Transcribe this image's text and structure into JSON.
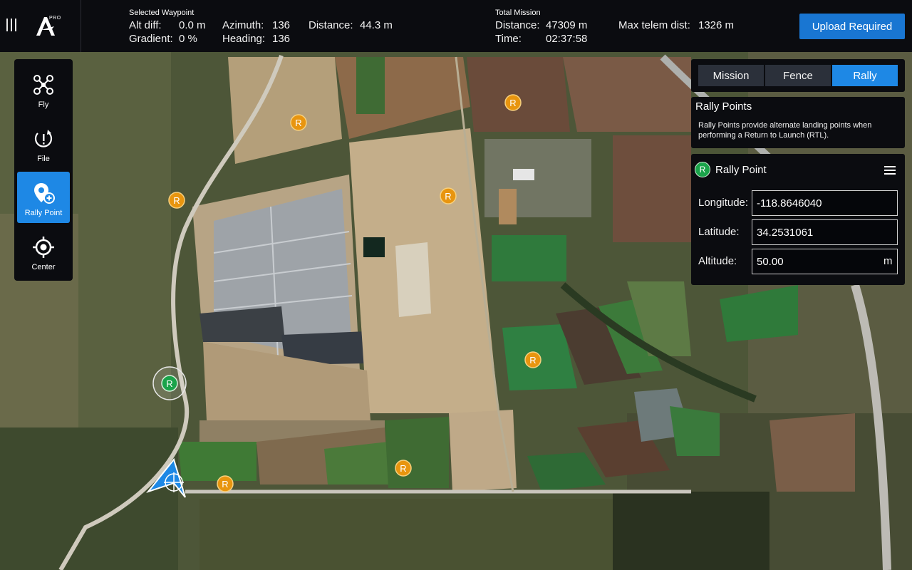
{
  "topbar": {
    "menu_icon": "hamburger-icon",
    "logo_icon": "app-logo-icon",
    "logo_badge": "PRO",
    "selected_waypoint": {
      "heading": "Selected Waypoint",
      "alt_diff_label": "Alt diff:",
      "alt_diff_value": "0.0 m",
      "gradient_label": "Gradient:",
      "gradient_value": "0 %",
      "azimuth_label": "Azimuth:",
      "azimuth_value": "136",
      "heading_label": "Heading:",
      "heading_value": "136",
      "distance_label": "Distance:",
      "distance_value": "44.3 m"
    },
    "total_mission": {
      "heading": "Total Mission",
      "distance_label": "Distance:",
      "distance_value": "47309 m",
      "time_label": "Time:",
      "time_value": "02:37:58",
      "max_telem_label": "Max telem dist:",
      "max_telem_value": "1326 m"
    },
    "upload_button": "Upload Required"
  },
  "toolbar": {
    "items": [
      {
        "label": "Fly",
        "icon": "drone-icon",
        "active": false
      },
      {
        "label": "File",
        "icon": "file-sync-icon",
        "active": false
      },
      {
        "label": "Rally Point",
        "icon": "add-location-icon",
        "active": true
      },
      {
        "label": "Center",
        "icon": "crosshair-icon",
        "active": false
      }
    ]
  },
  "panel": {
    "tabs": [
      {
        "label": "Mission",
        "active": false
      },
      {
        "label": "Fence",
        "active": false
      },
      {
        "label": "Rally",
        "active": true
      }
    ],
    "info_title": "Rally Points",
    "info_description": "Rally Points provide alternate landing points when performing a Return to Launch (RTL).",
    "rally_point": {
      "badge": "R",
      "title": "Rally Point",
      "menu_icon": "hamburger-icon",
      "longitude_label": "Longitude:",
      "longitude_value": "-118.8646040",
      "latitude_label": "Latitude:",
      "latitude_value": "34.2531061",
      "altitude_label": "Altitude:",
      "altitude_value": "50.00",
      "altitude_unit": "m"
    }
  },
  "map": {
    "marker_label": "R",
    "accent_color": "#1e88e5",
    "marker_color": "#e8950f",
    "selected_marker_color": "#1aa34a",
    "vehicle_icon": "vehicle-arrow-icon"
  }
}
